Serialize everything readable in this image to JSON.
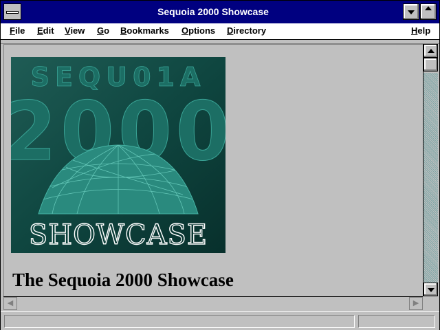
{
  "window": {
    "title": "Sequoia 2000 Showcase",
    "system_menu_icon": "system-menu-icon",
    "minimize_icon": "minimize-icon",
    "maximize_icon": "maximize-icon"
  },
  "menubar": {
    "items": [
      {
        "label": "File",
        "underline": "F",
        "rest": "ile"
      },
      {
        "label": "Edit",
        "underline": "E",
        "rest": "dit"
      },
      {
        "label": "View",
        "underline": "V",
        "rest": "iew"
      },
      {
        "label": "Go",
        "underline": "G",
        "rest": "o"
      },
      {
        "label": "Bookmarks",
        "underline": "B",
        "rest": "ookmarks"
      },
      {
        "label": "Options",
        "underline": "O",
        "rest": "ptions"
      },
      {
        "label": "Directory",
        "underline": "D",
        "rest": "irectory"
      },
      {
        "label": "Help",
        "underline": "H",
        "rest": "elp"
      }
    ]
  },
  "content": {
    "logo": {
      "line1": "SEQU01A",
      "line2": "2000",
      "line3": "SHOWCASE"
    },
    "heading": "The Sequoia 2000 Showcase"
  },
  "scrollbars": {
    "up_icon": "arrow-up-icon",
    "down_icon": "arrow-down-icon",
    "left_icon": "arrow-left-icon",
    "right_icon": "arrow-right-icon"
  },
  "colors": {
    "titlebar": "#000080",
    "logo_dark": "#0d3f3a",
    "logo_teal": "#2a8a7e"
  }
}
